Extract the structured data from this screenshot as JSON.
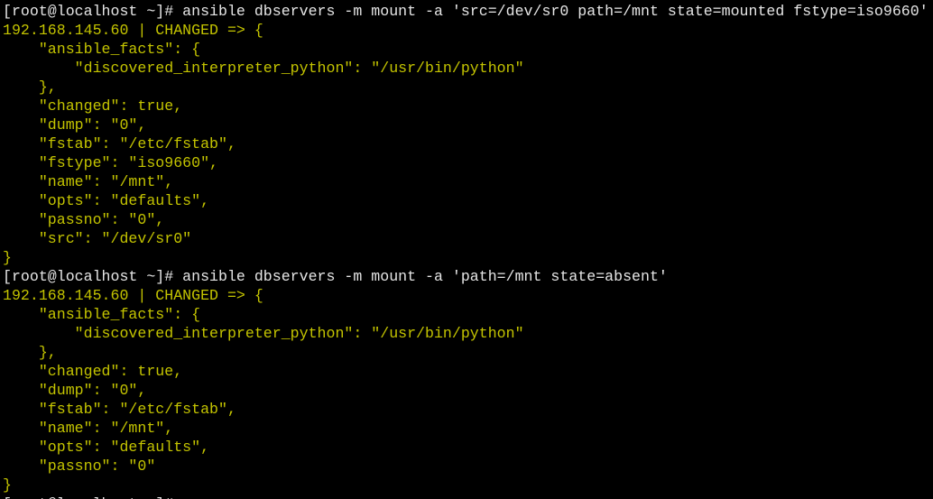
{
  "terminal": {
    "colors": {
      "background": "#000000",
      "command": "#e6e6e6",
      "output": "#c4c400"
    },
    "lines": [
      {
        "type": "cmd",
        "text": "[root@localhost ~]# ansible dbservers -m mount -a 'src=/dev/sr0 path=/mnt state=mounted fstype=iso9660'"
      },
      {
        "type": "out",
        "text": "192.168.145.60 | CHANGED => {"
      },
      {
        "type": "out",
        "text": "    \"ansible_facts\": {"
      },
      {
        "type": "out",
        "text": "        \"discovered_interpreter_python\": \"/usr/bin/python\""
      },
      {
        "type": "out",
        "text": "    },"
      },
      {
        "type": "out",
        "text": "    \"changed\": true,"
      },
      {
        "type": "out",
        "text": "    \"dump\": \"0\","
      },
      {
        "type": "out",
        "text": "    \"fstab\": \"/etc/fstab\","
      },
      {
        "type": "out",
        "text": "    \"fstype\": \"iso9660\","
      },
      {
        "type": "out",
        "text": "    \"name\": \"/mnt\","
      },
      {
        "type": "out",
        "text": "    \"opts\": \"defaults\","
      },
      {
        "type": "out",
        "text": "    \"passno\": \"0\","
      },
      {
        "type": "out",
        "text": "    \"src\": \"/dev/sr0\""
      },
      {
        "type": "out",
        "text": "}"
      },
      {
        "type": "cmd",
        "text": "[root@localhost ~]# ansible dbservers -m mount -a 'path=/mnt state=absent'"
      },
      {
        "type": "out",
        "text": "192.168.145.60 | CHANGED => {"
      },
      {
        "type": "out",
        "text": "    \"ansible_facts\": {"
      },
      {
        "type": "out",
        "text": "        \"discovered_interpreter_python\": \"/usr/bin/python\""
      },
      {
        "type": "out",
        "text": "    },"
      },
      {
        "type": "out",
        "text": "    \"changed\": true,"
      },
      {
        "type": "out",
        "text": "    \"dump\": \"0\","
      },
      {
        "type": "out",
        "text": "    \"fstab\": \"/etc/fstab\","
      },
      {
        "type": "out",
        "text": "    \"name\": \"/mnt\","
      },
      {
        "type": "out",
        "text": "    \"opts\": \"defaults\","
      },
      {
        "type": "out",
        "text": "    \"passno\": \"0\""
      },
      {
        "type": "out",
        "text": "}"
      },
      {
        "type": "cmd",
        "text": "[root@localhost ~]# "
      }
    ]
  }
}
